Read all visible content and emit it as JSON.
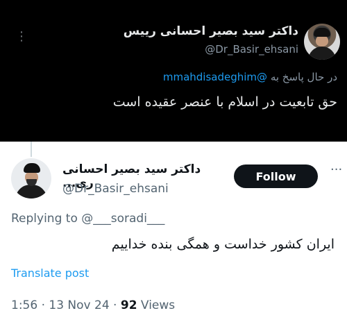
{
  "quoted_tweet": {
    "author_name": "داکتر سید بصیر احسانی رییس",
    "handle": "@Dr_Basir_ehsani",
    "reply_prefix": "در حال پاسخ به",
    "reply_mention": "@mmahdisadeghim",
    "text": "حق تابعیت در اسلام با عنصر عقیده است",
    "more_icon": "more-vertical-icon"
  },
  "tweet": {
    "author_name": "داکتر سید بصیر احسانی ری...",
    "handle": "@Dr_Basir_ehsani",
    "follow_label": "Follow",
    "replying_to": "Replying to @___soradi___",
    "text": "ایران کشور خداست و همگی بنده خداییم",
    "translate_label": "Translate post",
    "timestamp": "1:56 · 13 Nov 24 · ",
    "views_count": "92",
    "views_label": " Views",
    "more_icon": "more-horizontal-icon"
  },
  "colors": {
    "dark_bg": "#000000",
    "link": "#1d9bf0",
    "follow_bg": "#0f1419"
  }
}
